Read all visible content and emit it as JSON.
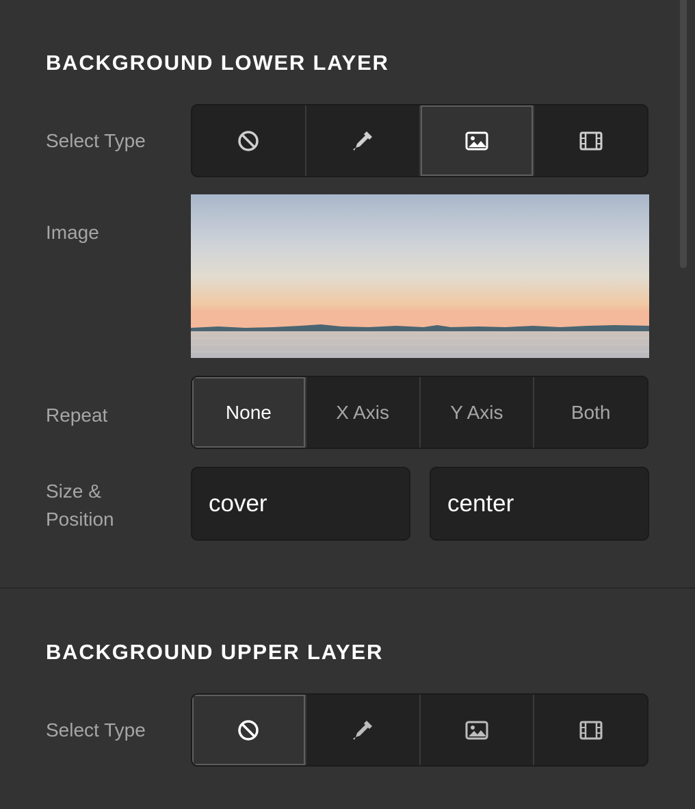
{
  "lower_layer": {
    "title": "BACKGROUND LOWER LAYER",
    "select_type": {
      "label": "Select Type",
      "options": [
        {
          "icon": "none-icon",
          "active": false
        },
        {
          "icon": "eyedropper-icon",
          "active": false
        },
        {
          "icon": "image-icon",
          "active": true
        },
        {
          "icon": "video-icon",
          "active": false
        }
      ]
    },
    "image": {
      "label": "Image"
    },
    "repeat": {
      "label": "Repeat",
      "options": [
        "None",
        "X Axis",
        "Y Axis",
        "Both"
      ],
      "selected": "None"
    },
    "size_position": {
      "label_line1": "Size &",
      "label_line2": "Position",
      "size_value": "cover",
      "position_value": "center"
    }
  },
  "upper_layer": {
    "title": "BACKGROUND UPPER LAYER",
    "select_type": {
      "label": "Select Type",
      "options": [
        {
          "icon": "none-icon",
          "active": true
        },
        {
          "icon": "eyedropper-icon",
          "active": false
        },
        {
          "icon": "image-icon",
          "active": false
        },
        {
          "icon": "video-icon",
          "active": false
        }
      ]
    }
  },
  "colors": {
    "panel_bg": "#333333",
    "control_bg": "#222222",
    "label_text": "#a6a6a6",
    "heading_text": "#ffffff"
  }
}
